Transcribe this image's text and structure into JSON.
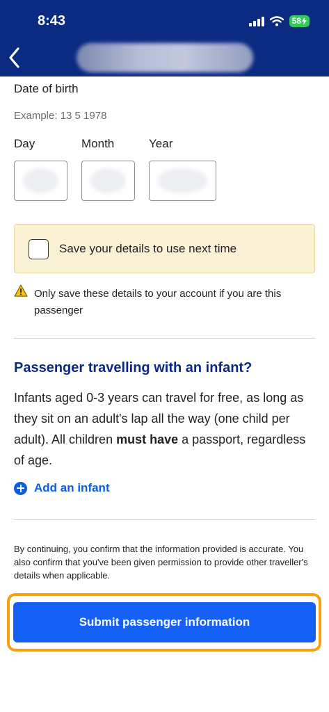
{
  "status_bar": {
    "time": "8:43",
    "battery": "58"
  },
  "header": {
    "back_icon": "chevron-left-icon"
  },
  "dob": {
    "label": "Date of birth",
    "example": "Example: 13 5 1978",
    "day_label": "Day",
    "month_label": "Month",
    "year_label": "Year"
  },
  "save": {
    "label": "Save your details to use next time",
    "warning": "Only save these details to your account if you are this passenger"
  },
  "infant": {
    "title": "Passenger travelling with an infant?",
    "body_pre": "Infants aged 0-3 years can travel for free, as long as they sit on an adult's lap all the way (one child per adult). All children ",
    "body_bold": "must have",
    "body_post": " a passport, regardless of age.",
    "add_label": "Add an infant"
  },
  "disclaimer": "By continuing, you confirm that the information provided is accurate. You also confirm that you've been given permission to provide other traveller's details when applicable.",
  "submit": {
    "label": "Submit passenger information"
  },
  "colors": {
    "header": "#0b2a82",
    "accent": "#1561f5",
    "highlight": "#f5a10e",
    "notice_bg": "#fbf2d5"
  }
}
